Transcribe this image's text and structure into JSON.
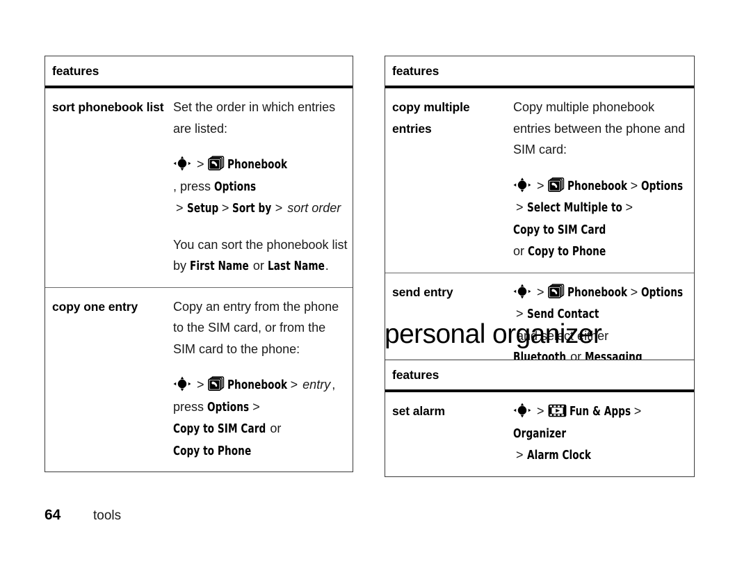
{
  "page": {
    "number": "64",
    "section_label": "tools",
    "heading": "personal organizer"
  },
  "icons": {
    "nav_key": "nav-key-icon",
    "phonebook": "phonebook-icon",
    "fun_apps": "fun-and-apps-icon"
  },
  "tables": {
    "left": {
      "header": "features",
      "rows": [
        {
          "term": "sort phonebook list",
          "lines": [
            {
              "type": "text",
              "runs": [
                {
                  "t": "Set the order in which entries",
                  "s": "plain"
                }
              ]
            },
            {
              "type": "text",
              "runs": [
                {
                  "t": "are listed:",
                  "s": "plain"
                }
              ]
            },
            {
              "type": "path",
              "gap": true,
              "runs": [
                {
                  "t": "nav-key-icon",
                  "s": "icon-nav"
                },
                {
                  "t": ">",
                  "s": "sep"
                },
                {
                  "t": "phonebook-icon",
                  "s": "icon-book"
                },
                {
                  "t": "Phonebook",
                  "s": "ui"
                },
                {
                  "t": ", press ",
                  "s": "plain-tight"
                },
                {
                  "t": "Options",
                  "s": "ui"
                }
              ]
            },
            {
              "type": "path",
              "runs": [
                {
                  "t": ">",
                  "s": "sep"
                },
                {
                  "t": "Setup",
                  "s": "ui"
                },
                {
                  "t": ">",
                  "s": "sep"
                },
                {
                  "t": "Sort by",
                  "s": "ui"
                },
                {
                  "t": ">",
                  "s": "sep"
                },
                {
                  "t": "sort order",
                  "s": "ital"
                }
              ]
            },
            {
              "type": "text",
              "gap": true,
              "runs": [
                {
                  "t": "You can sort the phonebook list",
                  "s": "plain"
                }
              ]
            },
            {
              "type": "path",
              "runs": [
                {
                  "t": "by ",
                  "s": "plain-tight"
                },
                {
                  "t": "First Name",
                  "s": "ui"
                },
                {
                  "t": " or ",
                  "s": "plain-tight"
                },
                {
                  "t": "Last Name",
                  "s": "ui"
                },
                {
                  "t": ".",
                  "s": "plain-tight"
                }
              ]
            }
          ]
        },
        {
          "term": "copy one entry",
          "lines": [
            {
              "type": "text",
              "runs": [
                {
                  "t": "Copy an entry from the phone",
                  "s": "plain"
                }
              ]
            },
            {
              "type": "text",
              "runs": [
                {
                  "t": "to the SIM card, or from the",
                  "s": "plain"
                }
              ]
            },
            {
              "type": "text",
              "runs": [
                {
                  "t": "SIM card to the phone:",
                  "s": "plain"
                }
              ]
            },
            {
              "type": "path",
              "gap": true,
              "runs": [
                {
                  "t": "nav-key-icon",
                  "s": "icon-nav"
                },
                {
                  "t": ">",
                  "s": "sep"
                },
                {
                  "t": "phonebook-icon",
                  "s": "icon-book"
                },
                {
                  "t": "Phonebook",
                  "s": "ui"
                },
                {
                  "t": ">",
                  "s": "sep"
                },
                {
                  "t": "entry",
                  "s": "ital"
                },
                {
                  "t": ",",
                  "s": "plain-tight"
                }
              ]
            },
            {
              "type": "path",
              "runs": [
                {
                  "t": "press ",
                  "s": "plain-tight"
                },
                {
                  "t": "Options",
                  "s": "ui"
                },
                {
                  "t": ">",
                  "s": "sep"
                },
                {
                  "t": "Copy to SIM Card",
                  "s": "ui"
                },
                {
                  "t": " or",
                  "s": "plain-tight"
                }
              ]
            },
            {
              "type": "path",
              "runs": [
                {
                  "t": "Copy to Phone",
                  "s": "ui"
                }
              ]
            }
          ]
        }
      ]
    },
    "right_top": {
      "header": "features",
      "rows": [
        {
          "term": "copy multiple entries",
          "lines": [
            {
              "type": "text",
              "runs": [
                {
                  "t": "Copy multiple phonebook",
                  "s": "plain"
                }
              ]
            },
            {
              "type": "text",
              "runs": [
                {
                  "t": "entries between the phone and",
                  "s": "plain"
                }
              ]
            },
            {
              "type": "text",
              "runs": [
                {
                  "t": "SIM card:",
                  "s": "plain"
                }
              ]
            },
            {
              "type": "path",
              "gap": true,
              "runs": [
                {
                  "t": "nav-key-icon",
                  "s": "icon-nav"
                },
                {
                  "t": ">",
                  "s": "sep"
                },
                {
                  "t": "phonebook-icon",
                  "s": "icon-book"
                },
                {
                  "t": "Phonebook",
                  "s": "ui"
                },
                {
                  "t": ">",
                  "s": "sep"
                },
                {
                  "t": "Options",
                  "s": "ui"
                }
              ]
            },
            {
              "type": "path",
              "runs": [
                {
                  "t": ">",
                  "s": "sep"
                },
                {
                  "t": "Select Multiple to",
                  "s": "ui"
                },
                {
                  "t": ">",
                  "s": "sep"
                },
                {
                  "t": "Copy to SIM Card",
                  "s": "ui"
                }
              ]
            },
            {
              "type": "path",
              "runs": [
                {
                  "t": "or ",
                  "s": "plain-tight"
                },
                {
                  "t": "Copy to Phone",
                  "s": "ui"
                }
              ]
            }
          ]
        },
        {
          "term": "send entry",
          "lines": [
            {
              "type": "path",
              "runs": [
                {
                  "t": "nav-key-icon",
                  "s": "icon-nav"
                },
                {
                  "t": ">",
                  "s": "sep"
                },
                {
                  "t": "phonebook-icon",
                  "s": "icon-book"
                },
                {
                  "t": "Phonebook",
                  "s": "ui"
                },
                {
                  "t": ">",
                  "s": "sep"
                },
                {
                  "t": "Options",
                  "s": "ui"
                }
              ]
            },
            {
              "type": "path",
              "runs": [
                {
                  "t": ">",
                  "s": "sep"
                },
                {
                  "t": "Send Contact",
                  "s": "ui"
                },
                {
                  "t": " and select either",
                  "s": "plain-tight"
                }
              ]
            },
            {
              "type": "path",
              "runs": [
                {
                  "t": "Bluetooth",
                  "s": "ui"
                },
                {
                  "t": " or ",
                  "s": "plain-tight"
                },
                {
                  "t": "Messaging",
                  "s": "ui"
                }
              ]
            }
          ]
        }
      ]
    },
    "right_bottom": {
      "header": "features",
      "rows": [
        {
          "term": "set alarm",
          "lines": [
            {
              "type": "path",
              "runs": [
                {
                  "t": "nav-key-icon",
                  "s": "icon-nav"
                },
                {
                  "t": ">",
                  "s": "sep"
                },
                {
                  "t": "fun-and-apps-icon",
                  "s": "icon-fun"
                },
                {
                  "t": "Fun & Apps",
                  "s": "ui"
                },
                {
                  "t": ">",
                  "s": "sep"
                },
                {
                  "t": "Organizer",
                  "s": "ui"
                }
              ]
            },
            {
              "type": "path",
              "runs": [
                {
                  "t": ">",
                  "s": "sep"
                },
                {
                  "t": "Alarm Clock",
                  "s": "ui"
                }
              ]
            }
          ]
        }
      ]
    }
  }
}
